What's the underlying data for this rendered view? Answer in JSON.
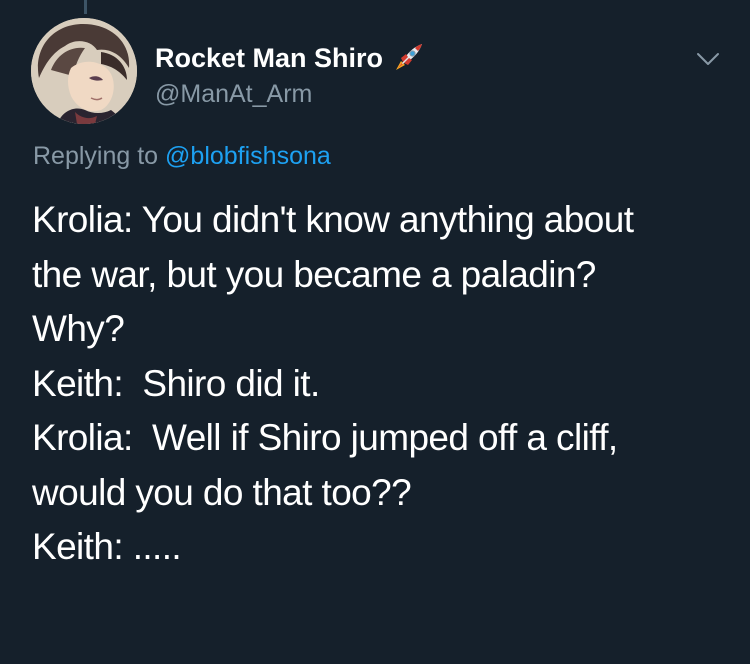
{
  "colors": {
    "background": "#15202b",
    "text_primary": "#ffffff",
    "text_secondary": "#8899a6",
    "link": "#1da1f2"
  },
  "author": {
    "display_name": "Rocket Man Shiro",
    "name_emoji": "rocket-icon",
    "handle": "@ManAt_Arm",
    "avatar": "avatar-anime-character"
  },
  "reply_context": {
    "prefix": "Replying to",
    "mention": "@blobfishsona"
  },
  "menu": {
    "icon": "chevron-down-icon"
  },
  "tweet": {
    "lines": [
      "Krolia: You didn't know anything about",
      "the war, but you became a paladin?",
      "Why?",
      "Keith:  Shiro did it.",
      "Krolia:  Well if Shiro jumped off a cliff,",
      "would you do that too??",
      "Keith: ....."
    ]
  }
}
